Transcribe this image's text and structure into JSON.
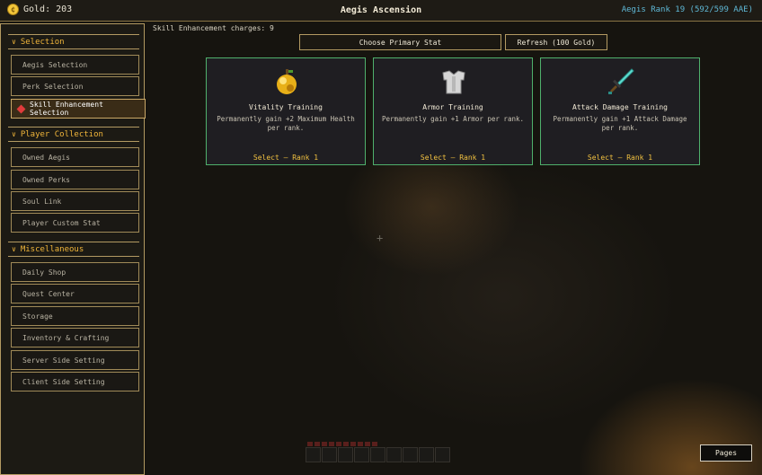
{
  "topbar": {
    "gold_label": "Gold: 203",
    "coin_glyph": "¢",
    "title": "Aegis Ascension",
    "rank_label": "Aegis Rank 19 (592/599 AAE)"
  },
  "sidebar": {
    "sections": [
      {
        "label": "Selection",
        "items": [
          "Aegis Selection",
          "Perk Selection",
          "Skill Enhancement Selection"
        ]
      },
      {
        "label": "Player Collection",
        "items": [
          "Owned Aegis",
          "Owned Perks",
          "Soul Link",
          "Player Custom Stat"
        ]
      },
      {
        "label": "Miscellaneous",
        "items": [
          "Daily Shop",
          "Quest Center",
          "Storage",
          "Inventory & Crafting",
          "Server Side Setting",
          "Client Side Setting"
        ]
      }
    ],
    "active_item": "Skill Enhancement Selection"
  },
  "main": {
    "charges_label": "Skill Enhancement charges: 9",
    "primary_button": "Choose Primary Stat",
    "refresh_button": "Refresh (100 Gold)",
    "cards": [
      {
        "icon": "golden-apple-icon",
        "name": "Vitality Training",
        "desc": "Permanently gain +2 Maximum Health per rank.",
        "select": "Select — Rank 1"
      },
      {
        "icon": "chestplate-icon",
        "name": "Armor Training",
        "desc": "Permanently gain +1 Armor per rank.",
        "select": "Select — Rank 1"
      },
      {
        "icon": "diamond-sword-icon",
        "name": "Attack Damage Training",
        "desc": "Permanently gain +1 Attack Damage per rank.",
        "select": "Select — Rank 1"
      }
    ],
    "pages_button": "Pages"
  },
  "colors": {
    "accent_gold": "#f0b53a",
    "border_tan": "#b39a62",
    "card_border": "#4fb06c",
    "rank_blue": "#5fb8d6",
    "active_marker": "#e03b3b"
  }
}
